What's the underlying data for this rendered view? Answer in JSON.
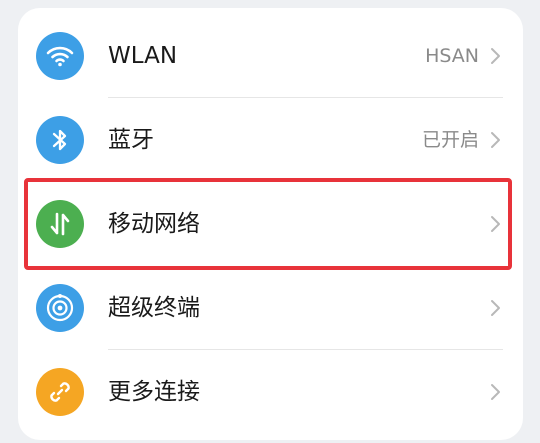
{
  "settings": {
    "items": [
      {
        "label": "WLAN",
        "value": "HSAN",
        "icon": "wifi-icon",
        "color": "#3d9fe6"
      },
      {
        "label": "蓝牙",
        "value": "已开启",
        "icon": "bluetooth-icon",
        "color": "#3d9fe6"
      },
      {
        "label": "移动网络",
        "value": "",
        "icon": "mobile-data-icon",
        "color": "#4caf50"
      },
      {
        "label": "超级终端",
        "value": "",
        "icon": "super-device-icon",
        "color": "#3d9fe6"
      },
      {
        "label": "更多连接",
        "value": "",
        "icon": "link-icon",
        "color": "#f5a623"
      }
    ]
  },
  "highlight_color": "#e8333a"
}
